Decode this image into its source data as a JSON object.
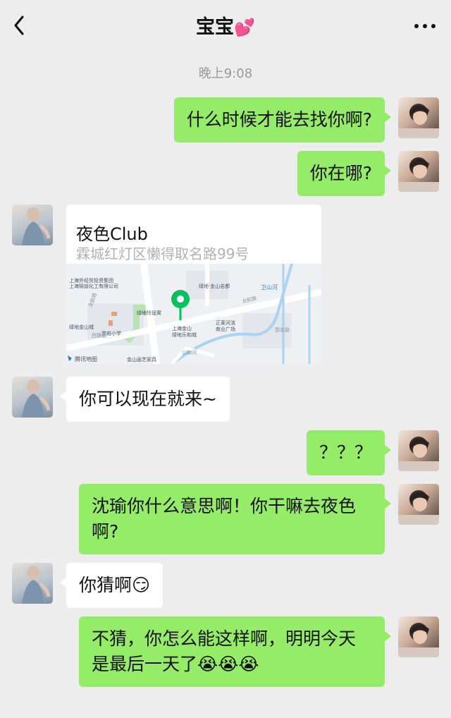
{
  "header": {
    "title": "宝宝",
    "title_emoji": "💕",
    "back_icon": "chevron-left-icon",
    "more_icon": "more-dots-icon"
  },
  "timestamp": "晚上9:08",
  "messages": [
    {
      "sender": "me",
      "text": "什么时候才能去找你啊?"
    },
    {
      "sender": "me",
      "text": "你在哪?"
    },
    {
      "sender": "her",
      "type": "location"
    },
    {
      "sender": "her",
      "text": "你可以现在就来~"
    },
    {
      "sender": "me",
      "text": "？？？"
    },
    {
      "sender": "me",
      "text": "沈瑜你什么意思啊！你干嘛去夜色啊?"
    },
    {
      "sender": "her",
      "text": "你猜啊😏"
    },
    {
      "sender": "me",
      "text": "不猜，你怎么能这样啊，明明今天是最后一天了😭😭😭"
    }
  ],
  "location_card": {
    "name": "夜色Club",
    "address": "霖城红灯区懒得取名路99号",
    "map_labels": {
      "company1": "上海外经贸投资集团",
      "company2": "上海锦迪化工有限公司",
      "jinshan_mingdu": "绿地·金山名都",
      "weishan_river": "卫山河",
      "longhang_road_1": "龙航路",
      "longhang_road_2": "龙航路",
      "linglong": "绿地玲珑寓",
      "jinshan_city": "绿地金山城",
      "school": "学府小学",
      "xijing": "西静路",
      "mall_1": "上海金山",
      "mall_2": "绿地乐和城",
      "zhengle_1": "正莱河滨",
      "zhengle_2": "商业广场",
      "gonghe": "公和河",
      "furniture": "金山画艺家具",
      "guoge": "郭名路",
      "attribution": "腾讯地图"
    }
  },
  "colors": {
    "my_bubble": "#95ec69",
    "her_bubble": "#ffffff",
    "background": "#ededed",
    "map_pin": "#07c160"
  }
}
